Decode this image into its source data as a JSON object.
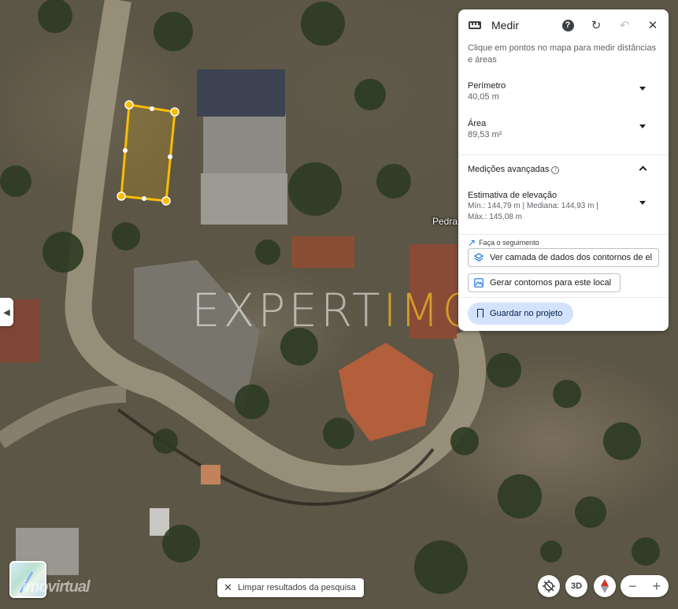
{
  "panel": {
    "title": "Medir",
    "instructions": "Clique em pontos no mapa para medir distâncias e áreas",
    "perimeter": {
      "label": "Perímetro",
      "value": "40,05 m"
    },
    "area": {
      "label": "Área",
      "value": "89,53 m²"
    },
    "advanced": {
      "label": "Medições avançadas"
    },
    "elevation": {
      "label": "Estimativa de elevação",
      "line1": "Mín.: 144,79 m | Mediana: 144,93 m |",
      "line2": "Máx.: 145,08 m"
    },
    "follow_label": "Faça o seguimento",
    "contour_layer_label": "Ver camada de dados dos contornos de el",
    "generate_contours_label": "Gerar contornos para este local",
    "save_label": "Guardar no projeto"
  },
  "map": {
    "place_label": "Pedra",
    "watermark_part1": "EXPERT",
    "watermark_part2": "IMO",
    "measure_color": "#fbbc04"
  },
  "bottom": {
    "clear_label": "Limpar resultados da pesquisa",
    "view_3d_label": "3D",
    "zoom_out": "−",
    "zoom_in": "+"
  },
  "icons": {
    "ruler": "ruler-icon",
    "help": "help-icon",
    "refresh": "refresh-icon",
    "undo": "undo-icon",
    "close": "close-icon",
    "layers": "layers-icon",
    "terrain": "terrain-icon",
    "bookmark": "bookmark-icon",
    "compass": "compass-icon",
    "locate": "locate-off-icon"
  }
}
